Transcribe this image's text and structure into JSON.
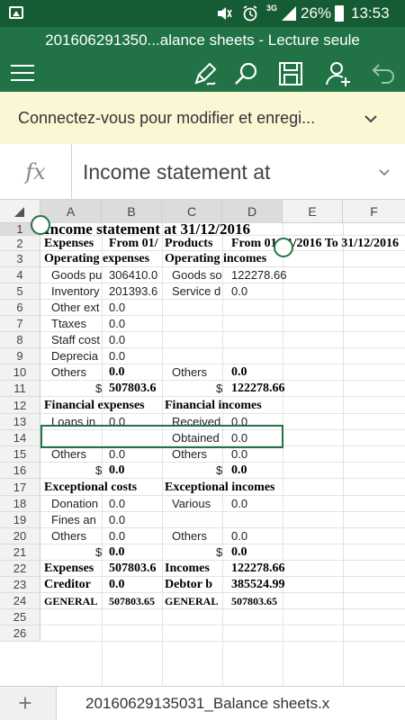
{
  "status_bar": {
    "signal_label": "3G",
    "battery_percent": "26%",
    "time": "13:53",
    "icons": [
      "gallery-icon",
      "mute-icon",
      "alarm-icon",
      "signal-icon",
      "battery-icon"
    ]
  },
  "app_bar": {
    "title": "201606291350...alance sheets - Lecture seule",
    "icons": [
      "menu-icon",
      "edit-pen-icon",
      "search-icon",
      "save-icon",
      "add-user-icon",
      "undo-icon"
    ]
  },
  "banner": {
    "text": "Connectez-vous pour modifier et enregi..."
  },
  "formula_bar": {
    "fx_label": "fx",
    "value": "Income statement at"
  },
  "grid": {
    "columns": [
      "A",
      "B",
      "C",
      "D",
      "E",
      "F"
    ],
    "rows": [
      "1",
      "2",
      "3",
      "4",
      "5",
      "6",
      "7",
      "8",
      "9",
      "10",
      "11",
      "12",
      "13",
      "14",
      "15",
      "16",
      "17",
      "18",
      "19",
      "20",
      "21",
      "22",
      "23",
      "24",
      "25",
      "26"
    ],
    "cells": {
      "r1": {
        "a": "Income statement at  31/12/2016"
      },
      "r2": {
        "a": "Expenses",
        "b": "From 01/",
        "c": "Products",
        "d": "From 01/01/2016 To 31/12/2016"
      },
      "r3": {
        "a": "Operating expenses",
        "c": "Operating incomes"
      },
      "r4": {
        "a": "Goods purchased",
        "b": "306410.0",
        "c": "Goods sold",
        "d": "122278.66"
      },
      "r5": {
        "a": "Inventory",
        "b": "201393.6",
        "c": "Service d",
        "d": "0.0"
      },
      "r6": {
        "a": "Other ext",
        "b": "0.0"
      },
      "r7": {
        "a": "Ttaxes",
        "b": "0.0"
      },
      "r8": {
        "a": "Staff cost",
        "b": "0.0"
      },
      "r9": {
        "a": "Deprecia",
        "b": "0.0"
      },
      "r10": {
        "a": "Others",
        "b": "0.0",
        "c": "Others",
        "d": "0.0"
      },
      "r11": {
        "a": "$",
        "b": "507803.6",
        "c": "$",
        "d": "122278.66"
      },
      "r12": {
        "a": "Financial expenses",
        "c": "Financial incomes"
      },
      "r13": {
        "a": "Loans in",
        "b": "0.0",
        "c": "Received",
        "d": "0.0"
      },
      "r14": {
        "c": "Obtained",
        "d": "0.0"
      },
      "r15": {
        "a": "Others",
        "b": "0.0",
        "c": "Others",
        "d": "0.0"
      },
      "r16": {
        "a": "$",
        "b": "0.0",
        "c": "$",
        "d": "0.0"
      },
      "r17": {
        "a": "Exceptional costs",
        "c": "Exceptional incomes"
      },
      "r18": {
        "a": "Donation",
        "b": "0.0",
        "c": "Various",
        "d": "0.0"
      },
      "r19": {
        "a": "Fines an",
        "b": "0.0"
      },
      "r20": {
        "a": "Others",
        "b": "0.0",
        "c": "Others",
        "d": "0.0"
      },
      "r21": {
        "a": "$",
        "b": "0.0",
        "c": "$",
        "d": "0.0"
      },
      "r22": {
        "a": "Expenses",
        "b": "507803.6",
        "c": "Incomes",
        "d": "122278.66"
      },
      "r23": {
        "a": "Creditor",
        "b": "0.0",
        "c": "Debtor b",
        "d": "385524.99"
      },
      "r24": {
        "a": "GENERAL",
        "b": "507803.65",
        "c": "GENERAL",
        "d": "507803.65"
      }
    }
  },
  "sheet_bar": {
    "add_label": "+",
    "tab_label": "20160629135031_Balance sheets.x"
  },
  "colors": {
    "status_bar": "#155c34",
    "app_bar": "#217346",
    "banner": "#fbf7d5",
    "selection": "#217346"
  }
}
